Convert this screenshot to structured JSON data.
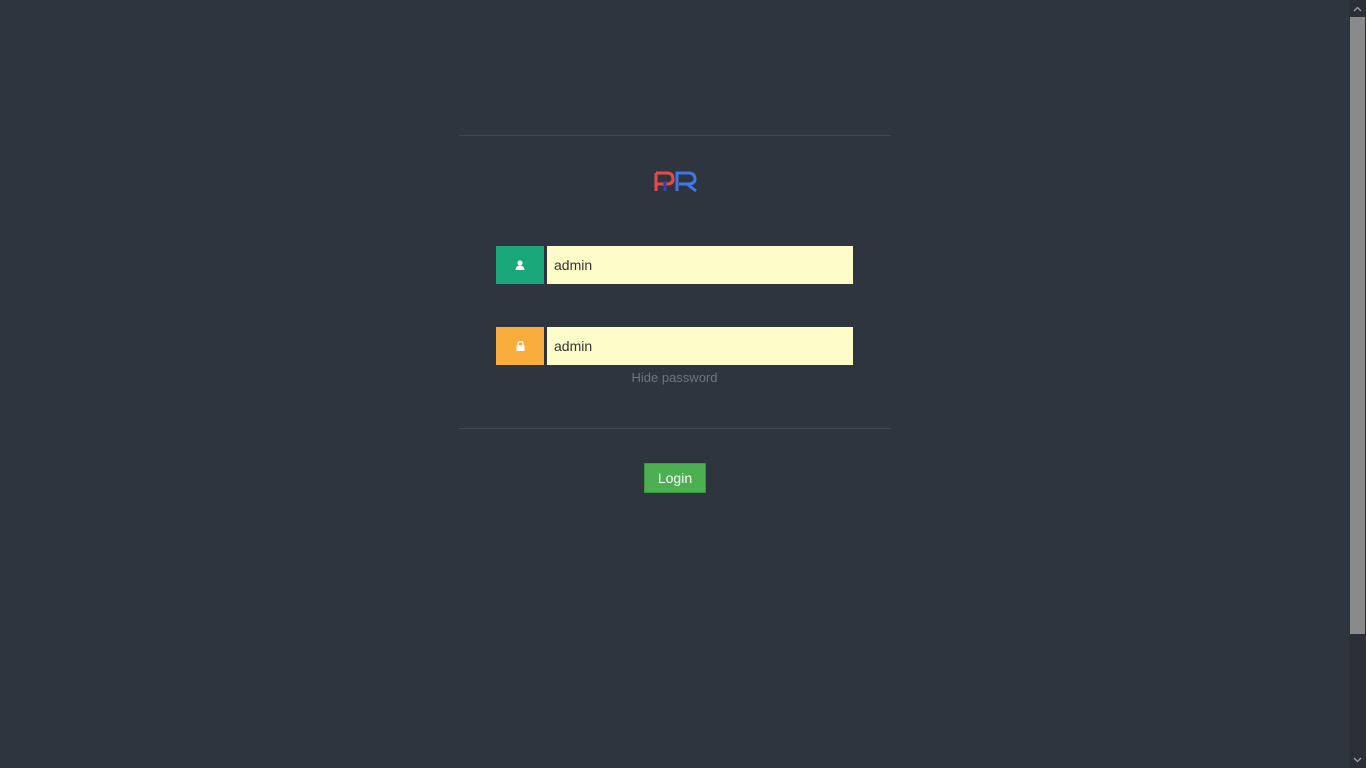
{
  "login_form": {
    "username": {
      "value": "admin",
      "icon": "user-icon",
      "icon_color": "#1aa779"
    },
    "password": {
      "value": "admin",
      "icon": "lock-icon",
      "icon_color": "#f9ad3c"
    },
    "hide_password_label": "Hide password",
    "login_label": "Login",
    "login_color": "#4cb050"
  },
  "logo": {
    "text": "PR",
    "colors": [
      "#e64a4a",
      "#3c78e6"
    ]
  },
  "theme": {
    "background": "#2f353e",
    "input_background": "#fefdca"
  }
}
